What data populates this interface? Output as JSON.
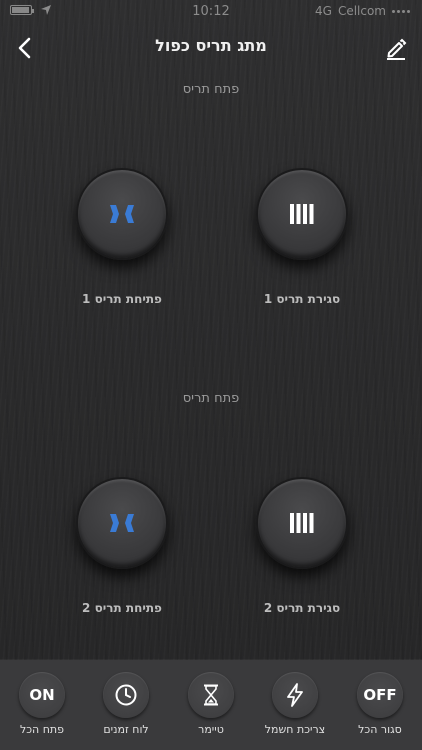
{
  "status_bar": {
    "time": "10:12",
    "network": "4G",
    "carrier": "Cellcom"
  },
  "header": {
    "title": "מתג תריס כפול"
  },
  "sections": [
    {
      "title": "פתח תריס",
      "close_label": "סגירת תריס 1",
      "open_label": "פתיחת תריס 1"
    },
    {
      "title": "פתח תריס",
      "close_label": "סגירת תריס 2",
      "open_label": "פתיחת תריס 2"
    }
  ],
  "bottom_bar": {
    "items": [
      {
        "badge": "ON",
        "label": "פתח הכל",
        "icon": "on-badge"
      },
      {
        "badge": "",
        "label": "לוח זמנים",
        "icon": "clock-icon"
      },
      {
        "badge": "",
        "label": "טיימר",
        "icon": "hourglass-icon"
      },
      {
        "badge": "",
        "label": "צריכת חשמל",
        "icon": "lightning-icon"
      },
      {
        "badge": "OFF",
        "label": "סגור הכל",
        "icon": "off-badge"
      }
    ]
  },
  "colors": {
    "accent_blue": "#3a7bd5",
    "shutter_white": "#ffffff"
  }
}
